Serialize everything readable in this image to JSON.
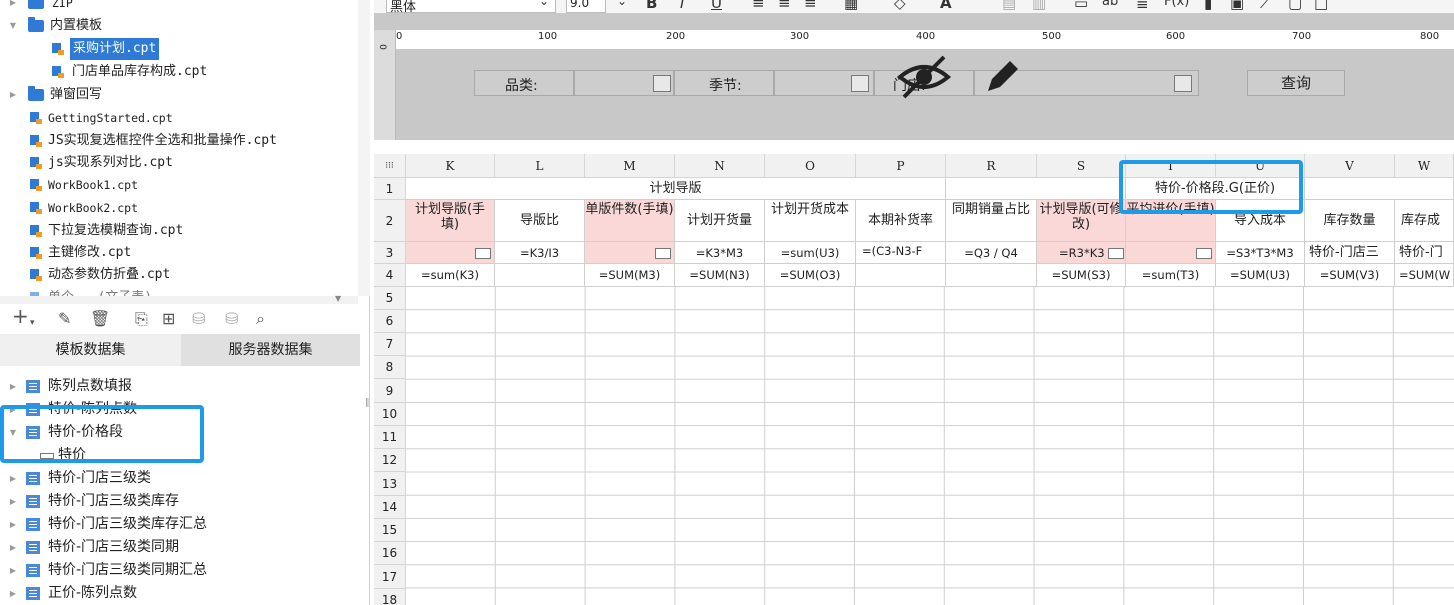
{
  "left_panel": {
    "tree": [
      {
        "label": "ZIP",
        "type": "folder",
        "indent": 0
      },
      {
        "label": "内置模板",
        "type": "folder",
        "indent": 0,
        "expanded": true
      },
      {
        "label": "采购计划.cpt",
        "type": "file",
        "indent": 1,
        "selected": true
      },
      {
        "label": "门店单品库存构成.cpt",
        "type": "file",
        "indent": 1
      },
      {
        "label": "弹窗回写",
        "type": "folder",
        "indent": 0
      },
      {
        "label": "GettingStarted.cpt",
        "type": "file",
        "indent": 0
      },
      {
        "label": "JS实现复选框控件全选和批量操作.cpt",
        "type": "file",
        "indent": 0
      },
      {
        "label": "js实现系列对比.cpt",
        "type": "file",
        "indent": 0
      },
      {
        "label": "WorkBook1.cpt",
        "type": "file",
        "indent": 0
      },
      {
        "label": "WorkBook2.cpt",
        "type": "file",
        "indent": 0
      },
      {
        "label": "下拉复选模糊查询.cpt",
        "type": "file",
        "indent": 0
      },
      {
        "label": "主键修改.cpt",
        "type": "file",
        "indent": 0
      },
      {
        "label": "动态参数仿折叠.cpt",
        "type": "file",
        "indent": 0
      },
      {
        "label": "单个...(文子表)",
        "type": "file",
        "indent": 0
      }
    ],
    "toolbar_icons": [
      "add-icon",
      "edit-icon",
      "delete-icon",
      "preview-icon",
      "sql-preview-icon",
      "database-icon",
      "server-database-icon",
      "search-icon"
    ],
    "tabs": {
      "template_dataset": "模板数据集",
      "server_dataset": "服务器数据集"
    },
    "datasets": [
      {
        "label": "陈列点数填报",
        "indent": 0
      },
      {
        "label": "特价-陈列点数",
        "indent": 0
      },
      {
        "label": "特价-价格段",
        "indent": 0,
        "expanded": true
      },
      {
        "label": "特价",
        "indent": 1,
        "field": true
      },
      {
        "label": "特价-门店三级类",
        "indent": 0
      },
      {
        "label": "特价-门店三级类库存",
        "indent": 0
      },
      {
        "label": "特价-门店三级类库存汇总",
        "indent": 0
      },
      {
        "label": "特价-门店三级类同期",
        "indent": 0
      },
      {
        "label": "特价-门店三级类同期汇总",
        "indent": 0
      },
      {
        "label": "正价-陈列点数",
        "indent": 0
      }
    ]
  },
  "format_toolbar": {
    "font_name": "黑体",
    "font_size": "9.0"
  },
  "param_panel": {
    "ruler_ticks": [
      "0",
      "100",
      "200",
      "300",
      "400",
      "500",
      "600",
      "700",
      "800"
    ],
    "category_label": "品类:",
    "season_label": "季节:",
    "store_label": "门店:",
    "query_button": "查询"
  },
  "sheet": {
    "columns": [
      "K",
      "L",
      "M",
      "N",
      "O",
      "P",
      "R",
      "S",
      "T",
      "U",
      "V",
      "W"
    ],
    "row_numbers": [
      "1",
      "2",
      "3",
      "4",
      "5",
      "6",
      "7",
      "8",
      "9",
      "10",
      "11",
      "12",
      "13",
      "14",
      "15",
      "16",
      "17",
      "18"
    ],
    "row1": {
      "plan_header": "计划导版",
      "price_segment": "特价-价格段.G(正价)"
    },
    "row2": [
      "计划导版(手填)",
      "导版比",
      "单版件数(手填)",
      "计划开货量",
      "计划开货成本",
      "本期补货率",
      "同期销量占比",
      "计划导版(可修改)",
      "平均进价(手填)",
      "导入成本",
      "库存数量",
      "库存成"
    ],
    "row3": [
      "",
      "=K3/I3",
      "",
      "=K3*M3",
      "=sum(U3)",
      "=(C3-N3-F",
      "=Q3 / Q4",
      "=R3*K3",
      "",
      "=S3*T3*M3",
      "特价-门店三",
      "特价-门"
    ],
    "row4": [
      "=sum(K3)",
      "",
      "=SUM(M3)",
      "=SUM(N3)",
      "=SUM(O3)",
      "",
      "",
      "=SUM(S3)",
      "=sum(T3)",
      "=SUM(U3)",
      "=SUM(V3)",
      "=SUM(W"
    ]
  }
}
